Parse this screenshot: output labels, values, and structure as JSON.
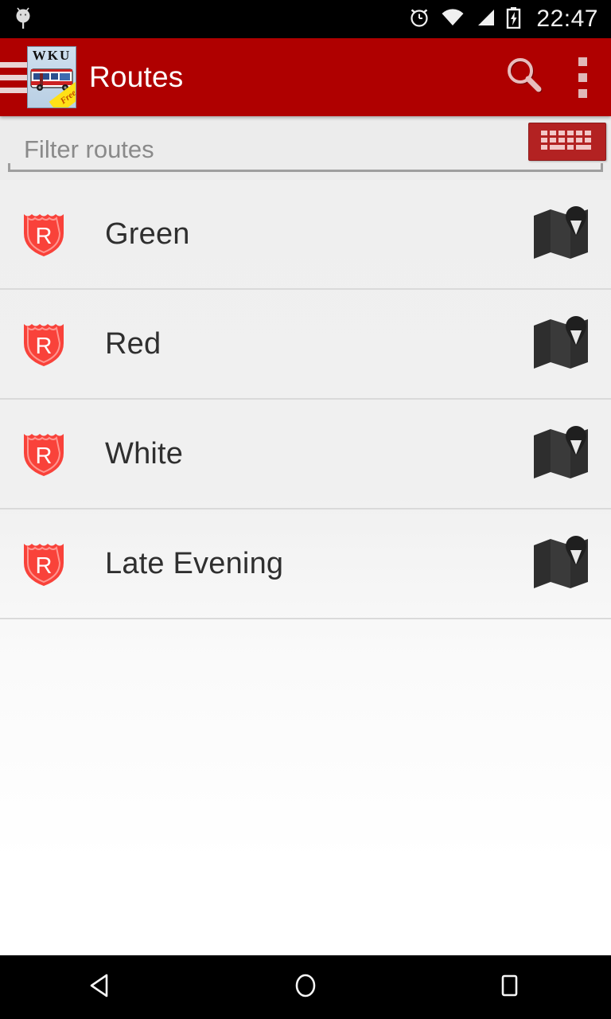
{
  "status_bar": {
    "notification_icon": "android-robot-icon",
    "icons": [
      "alarm-icon",
      "wifi-icon",
      "cellular-signal-icon",
      "battery-charging-icon"
    ],
    "time": "22:47"
  },
  "action_bar": {
    "menu_icon": "hamburger-menu-icon",
    "app_icon": {
      "name": "wku-bus-app-icon",
      "label": "WKU",
      "badge": "Free"
    },
    "title": "Routes",
    "search_icon": "search-icon",
    "overflow_icon": "overflow-menu-icon",
    "background_color": "#af0000"
  },
  "filter": {
    "placeholder": "Filter routes",
    "value": "",
    "keyboard_button_icon": "keyboard-icon",
    "keyboard_button_color": "#b32222"
  },
  "routes": [
    {
      "badge": "R",
      "name": "Green",
      "map_icon": "map-pin-icon"
    },
    {
      "badge": "R",
      "name": "Red",
      "map_icon": "map-pin-icon"
    },
    {
      "badge": "R",
      "name": "White",
      "map_icon": "map-pin-icon"
    },
    {
      "badge": "R",
      "name": "Late Evening",
      "map_icon": "map-pin-icon"
    }
  ],
  "nav_bar": {
    "back": "back-triangle-icon",
    "home": "home-circle-icon",
    "recents": "recents-square-icon"
  },
  "colors": {
    "accent_red": "#af0000",
    "shield_red": "#f9423a",
    "list_background": "#efefef",
    "text_primary": "#2f2f2f",
    "placeholder": "#8a8a8a"
  }
}
